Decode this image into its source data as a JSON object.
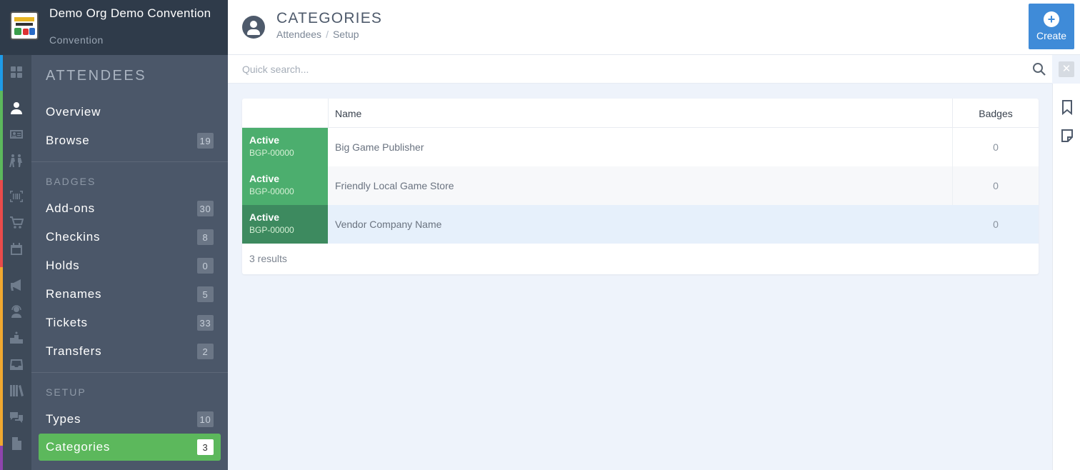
{
  "brand": {
    "name": "Demo Org Demo Convention",
    "subtitle": "Convention"
  },
  "rail": {
    "icons": [
      "dashboard-icon",
      "person-icon",
      "id-card-icon",
      "people-walking-icon",
      "barcode-icon",
      "cart-icon",
      "calendar-icon",
      "megaphone-icon",
      "support-agent-icon",
      "podium-icon",
      "inbox-icon",
      "library-icon",
      "chat-icon",
      "document-icon"
    ],
    "active": "person-icon",
    "stripe_colors": [
      "#1e9be8",
      "#5cb85c",
      "#e94b4b",
      "#f0a830",
      "#8e44ad"
    ]
  },
  "nav": {
    "title": "ATTENDEES",
    "top_items": [
      {
        "label": "Overview",
        "count": ""
      },
      {
        "label": "Browse",
        "count": "19"
      }
    ],
    "badges_section": "BADGES",
    "badge_items": [
      {
        "label": "Add-ons",
        "count": "30"
      },
      {
        "label": "Checkins",
        "count": "8"
      },
      {
        "label": "Holds",
        "count": "0"
      },
      {
        "label": "Renames",
        "count": "5"
      },
      {
        "label": "Tickets",
        "count": "33"
      },
      {
        "label": "Transfers",
        "count": "2"
      }
    ],
    "setup_section": "SETUP",
    "setup_items": [
      {
        "label": "Types",
        "count": "10"
      },
      {
        "label": "Categories",
        "count": "3"
      }
    ],
    "active_item": "Categories",
    "active_color": "#5cb85c"
  },
  "header": {
    "title": "CATEGORIES",
    "breadcrumb": [
      "Attendees",
      "Setup"
    ],
    "create_label": "Create"
  },
  "search": {
    "placeholder": "Quick search..."
  },
  "table": {
    "columns": [
      "",
      "Name",
      "Badges"
    ],
    "rows": [
      {
        "status": "Active",
        "code": "BGP-00000",
        "name": "Big Game Publisher",
        "badges": "0"
      },
      {
        "status": "Active",
        "code": "BGP-00000",
        "name": "Friendly Local Game Store",
        "badges": "0"
      },
      {
        "status": "Active",
        "code": "BGP-00000",
        "name": "Vendor Company Name",
        "badges": "0"
      }
    ],
    "results_text": "3 results",
    "status_color": "#4cae6e",
    "status_color_hover": "#3d8a5f",
    "hover_row_color": "#e6f0fb"
  }
}
